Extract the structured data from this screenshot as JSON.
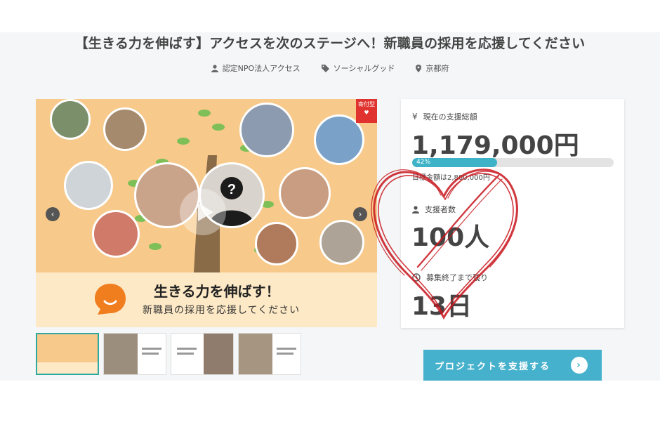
{
  "project": {
    "title": "【生きる力を伸ばす】アクセスを次のステージへ！新職員の採用を応援してください",
    "meta": [
      {
        "icon": "user-icon",
        "text": "認定NPO法人アクセス"
      },
      {
        "icon": "tag-icon",
        "text": "ソーシャルグッド"
      },
      {
        "icon": "location-pin-icon",
        "text": "京都府"
      }
    ]
  },
  "hero": {
    "badge": "寄付型",
    "caption_main": "生きる力を伸ばす！",
    "caption_sub": "新職員の採用を応援してください",
    "prev_glyph": "‹",
    "next_glyph": "›"
  },
  "stats": {
    "total_label": "現在の支援総額",
    "total_value": "1,179,000円",
    "progress_percent": 42,
    "progress_text": "42%",
    "goal_text": "目標金額は2,800,000円",
    "supporters_label": "支援者数",
    "supporters_value": "100人",
    "remaining_label": "募集終了まで残り",
    "remaining_value": "13日"
  },
  "cta": {
    "label": "プロジェクトを支援する",
    "arrow": "›"
  },
  "thumbnails": [
    {
      "name": "thumbnail-1",
      "active": true
    },
    {
      "name": "thumbnail-2",
      "active": false
    },
    {
      "name": "thumbnail-3",
      "active": false
    },
    {
      "name": "thumbnail-4",
      "active": false
    }
  ],
  "colors": {
    "accent": "#46b1cc",
    "progress": "#3eb3c8",
    "hero_bg": "#f7c98a",
    "heart_overlay": "#c8161d"
  }
}
